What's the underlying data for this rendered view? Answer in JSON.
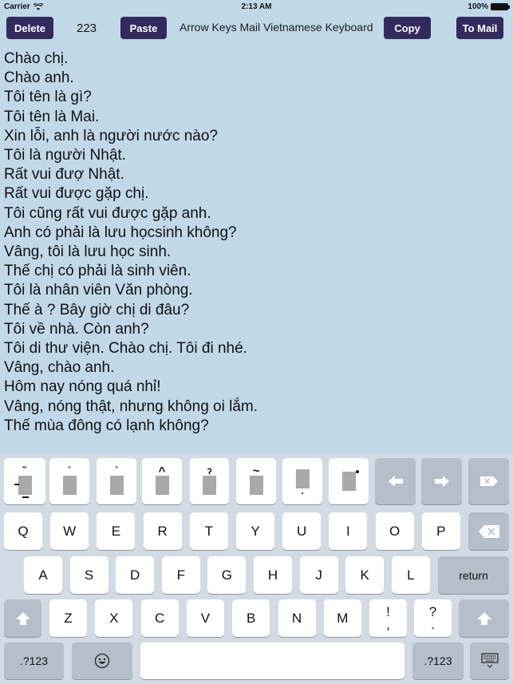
{
  "status_bar": {
    "carrier": "Carrier",
    "time": "2:13 AM",
    "battery": "100%"
  },
  "toolbar": {
    "delete_label": "Delete",
    "char_count": "223",
    "paste_label": "Paste",
    "title": "Arrow Keys Mail Vietnamese Keyboard",
    "copy_label": "Copy",
    "to_mail_label": "To Mail",
    "button_color": "#332a5e"
  },
  "editor": {
    "lines": [
      "Chào chị.",
      "Chào anh.",
      "Tôi tên là gì?",
      "Tôi tên là Mai.",
      "Xin lỗi, anh là người nước nào?",
      "Tôi là người Nhật.",
      "Rất vui đượ Nhật.",
      "Rất vui được gặp chị.",
      "Tôi cũng rất vui được gặp anh.",
      "Anh có phải là lưu họcsinh không?",
      "Vâng, tôi là lưu học sinh.",
      "Thế chị có phải là sinh viên.",
      "Tôi là nhân viên Văn phòng.",
      "Thế à ? Bây giờ chị di đâu?",
      "Tôi về nhà. Còn anh?",
      "Tôi di thư viện. Chào chị. Tôi đi nhé.",
      "Vâng, chào anh.",
      "Hôm nay nóng quá nhỉ!",
      "Vâng, nóng thật, nhưng không oi lắm.",
      "Thế mùa đông có lạnh không?"
    ]
  },
  "keyboard": {
    "accent_row": [
      {
        "name": "breve-macron",
        "mark": "˘"
      },
      {
        "name": "acute",
        "mark": "´"
      },
      {
        "name": "grave",
        "mark": "`"
      },
      {
        "name": "circumflex",
        "mark": "^"
      },
      {
        "name": "hook-above",
        "mark": "̉"
      },
      {
        "name": "tilde",
        "mark": "~"
      },
      {
        "name": "dot-below",
        "mark": "."
      },
      {
        "name": "horn",
        "mark": "ʼ"
      }
    ],
    "arrow_left_icon": "arrow-left-icon",
    "arrow_right_icon": "arrow-right-icon",
    "delete_icon": "delete-icon",
    "row1": [
      "Q",
      "W",
      "E",
      "R",
      "T",
      "Y",
      "U",
      "I",
      "O",
      "P"
    ],
    "row2": [
      "A",
      "S",
      "D",
      "F",
      "G",
      "H",
      "J",
      "K",
      "L"
    ],
    "return_label": "return",
    "row3": [
      "Z",
      "X",
      "C",
      "V",
      "B",
      "N",
      "M"
    ],
    "punct1_top": "!",
    "punct1_bottom": ",",
    "punct2_top": "?",
    "punct2_bottom": ".",
    "numbers_label": ".?123",
    "emoji_icon": "emoji-icon",
    "hide_keyboard_icon": "hide-keyboard-icon"
  }
}
